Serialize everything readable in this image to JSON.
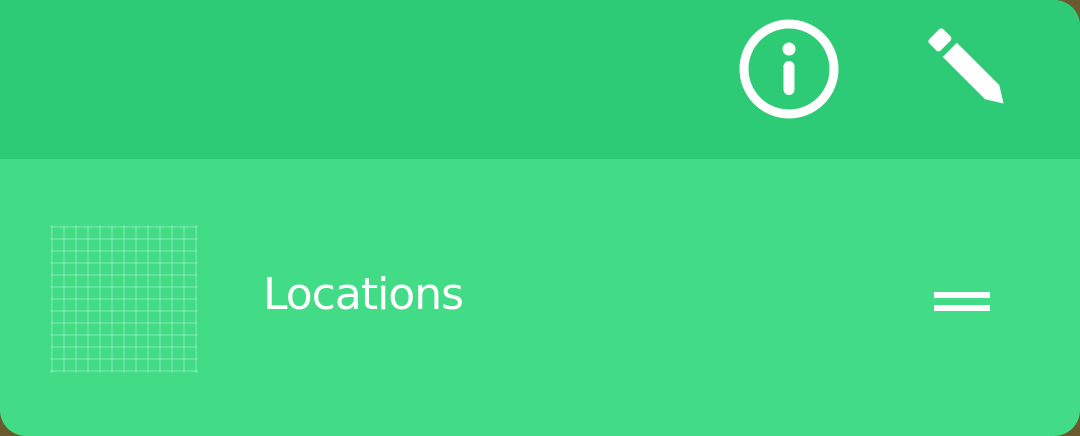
{
  "header": {
    "actions": [
      {
        "id": "info",
        "icon": "info-icon"
      },
      {
        "id": "edit",
        "icon": "pencil-icon"
      }
    ]
  },
  "list": {
    "items": [
      {
        "label": "Locations",
        "icon": "grid-thumbnail-icon",
        "handle_icon": "drag-handle-icon"
      }
    ]
  },
  "colors": {
    "header_bg": "#2ecb76",
    "row_bg": "#42dc87",
    "foreground": "#ffffff"
  }
}
